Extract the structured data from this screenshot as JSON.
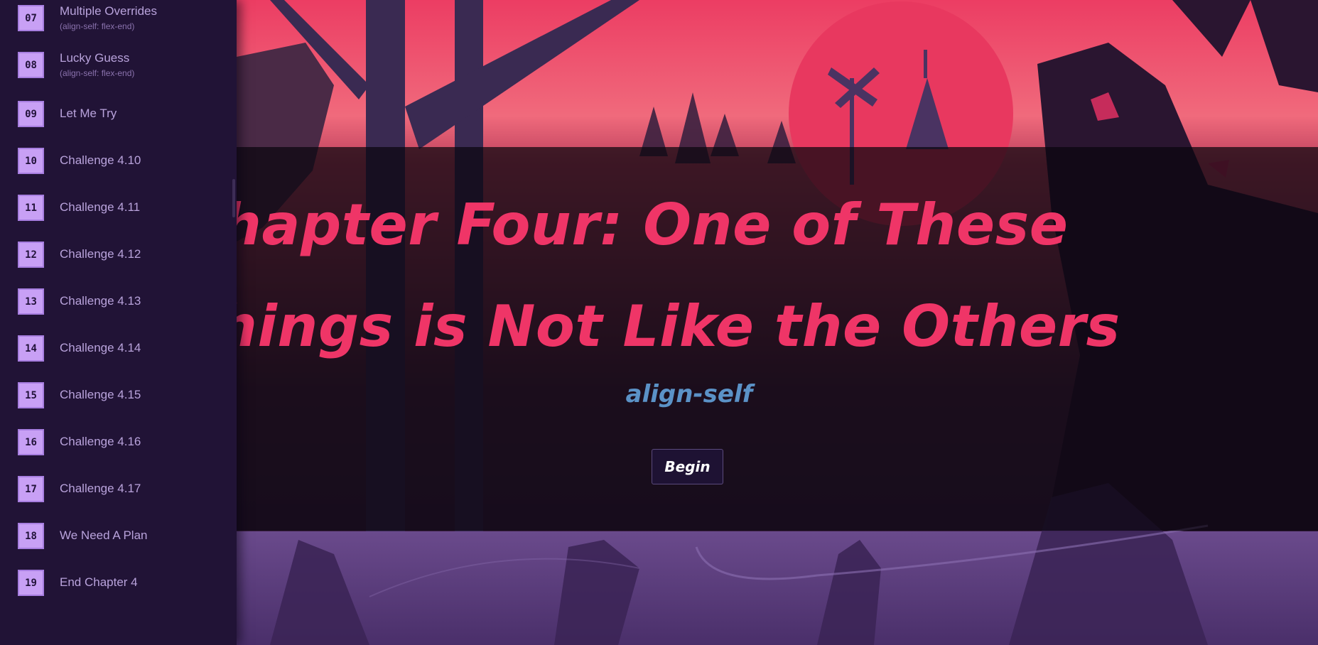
{
  "sidebar": {
    "items": [
      {
        "num": "07",
        "label": "Multiple Overrides",
        "sub": "(align-self: flex-end)"
      },
      {
        "num": "08",
        "label": "Lucky Guess",
        "sub": "(align-self: flex-end)"
      },
      {
        "num": "09",
        "label": "Let Me Try",
        "sub": ""
      },
      {
        "num": "10",
        "label": "Challenge 4.10",
        "sub": ""
      },
      {
        "num": "11",
        "label": "Challenge 4.11",
        "sub": ""
      },
      {
        "num": "12",
        "label": "Challenge 4.12",
        "sub": ""
      },
      {
        "num": "13",
        "label": "Challenge 4.13",
        "sub": ""
      },
      {
        "num": "14",
        "label": "Challenge 4.14",
        "sub": ""
      },
      {
        "num": "15",
        "label": "Challenge 4.15",
        "sub": ""
      },
      {
        "num": "16",
        "label": "Challenge 4.16",
        "sub": ""
      },
      {
        "num": "17",
        "label": "Challenge 4.17",
        "sub": ""
      },
      {
        "num": "18",
        "label": "We Need A Plan",
        "sub": ""
      },
      {
        "num": "19",
        "label": "End Chapter 4",
        "sub": ""
      }
    ]
  },
  "main": {
    "title_line1": "hapter Four: One of These",
    "title_line2": "hings is Not Like the Others",
    "subtitle": "align-self",
    "begin_label": "Begin"
  },
  "colors": {
    "accent": "#ef3567",
    "subtitle": "#5b92c7",
    "badge": "#c8a0f5",
    "sidebar_bg": "#211336"
  }
}
